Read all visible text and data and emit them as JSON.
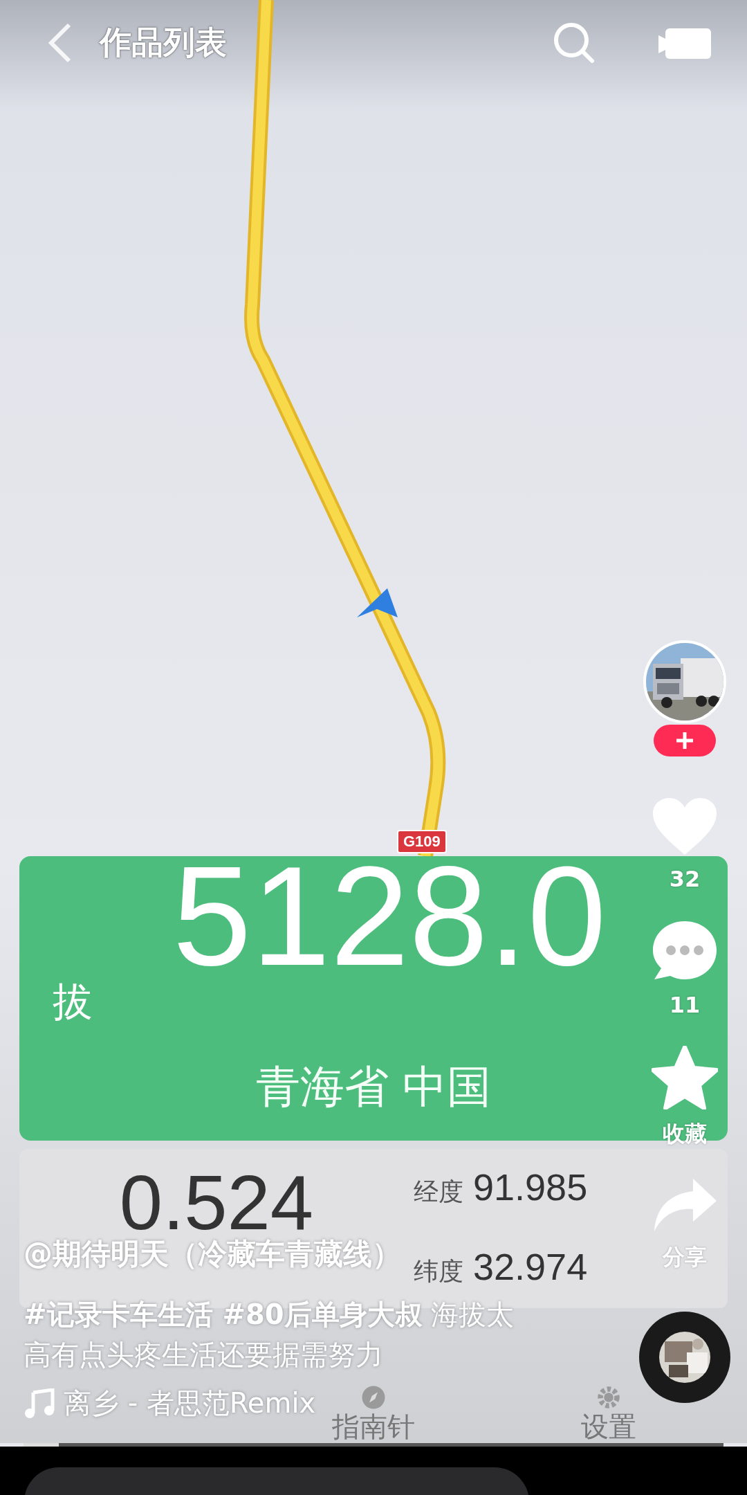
{
  "top_bar": {
    "title": "作品列表"
  },
  "video_screen": {
    "route_label": "G109",
    "altitude_card": {
      "label": "拔",
      "value": "5128.0",
      "location": "青海省 中国"
    },
    "info_card": {
      "pressure": "0.524",
      "longitude_label": "经度",
      "longitude": "91.985",
      "latitude_label": "纬度",
      "latitude": "32.974"
    },
    "bottom_nav": [
      {
        "kind": "compass",
        "label": "指南针",
        "selected": false
      },
      {
        "kind": "settings",
        "label": "设置",
        "selected": false
      }
    ]
  },
  "actions": [
    {
      "kind": "like",
      "label": "32"
    },
    {
      "kind": "comment",
      "label": "11"
    },
    {
      "kind": "favorite",
      "label": "收藏"
    },
    {
      "kind": "share",
      "label": "分享"
    }
  ],
  "caption": {
    "author": "@期待明天（冷藏车青藏线）",
    "description": "**#记录卡车生活 #80后单身大叔** 海拔太高有点头疼生活还要据需努力",
    "music": "离乡 - 者思范Remix"
  },
  "video_progress": {
    "level": 0.05
  }
}
